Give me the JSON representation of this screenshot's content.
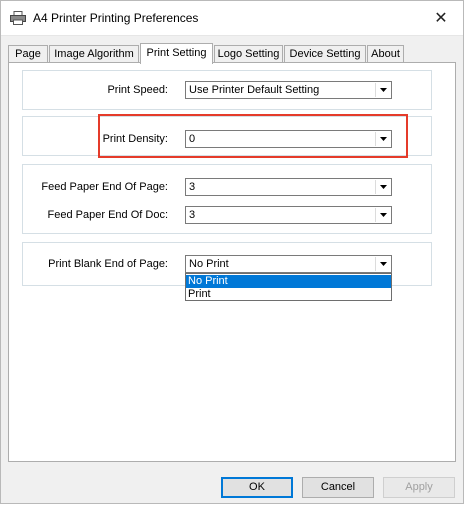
{
  "window": {
    "title": "A4 Printer Printing Preferences",
    "close_glyph": "✕"
  },
  "tabs": [
    {
      "label": "Page",
      "active": false
    },
    {
      "label": "Image Algorithm",
      "active": false
    },
    {
      "label": "Print Setting",
      "active": true
    },
    {
      "label": "Logo Setting",
      "active": false
    },
    {
      "label": "Device Setting",
      "active": false
    },
    {
      "label": "About",
      "active": false
    }
  ],
  "settings": {
    "print_speed": {
      "label": "Print Speed:",
      "value": "Use Printer Default Setting"
    },
    "print_density": {
      "label": "Print Density:",
      "value": "0"
    },
    "feed_end_page": {
      "label": "Feed Paper End Of Page:",
      "value": "3"
    },
    "feed_end_doc": {
      "label": "Feed Paper End Of Doc:",
      "value": "3"
    },
    "blank_end_page": {
      "label": "Print Blank End of Page:",
      "value": "No Print",
      "options": [
        "No Print",
        "Print"
      ],
      "selected_option": "No Print"
    }
  },
  "buttons": {
    "ok": "OK",
    "cancel": "Cancel",
    "apply": "Apply"
  },
  "colors": {
    "highlight": "#e53b2a",
    "selection": "#0078d7"
  }
}
